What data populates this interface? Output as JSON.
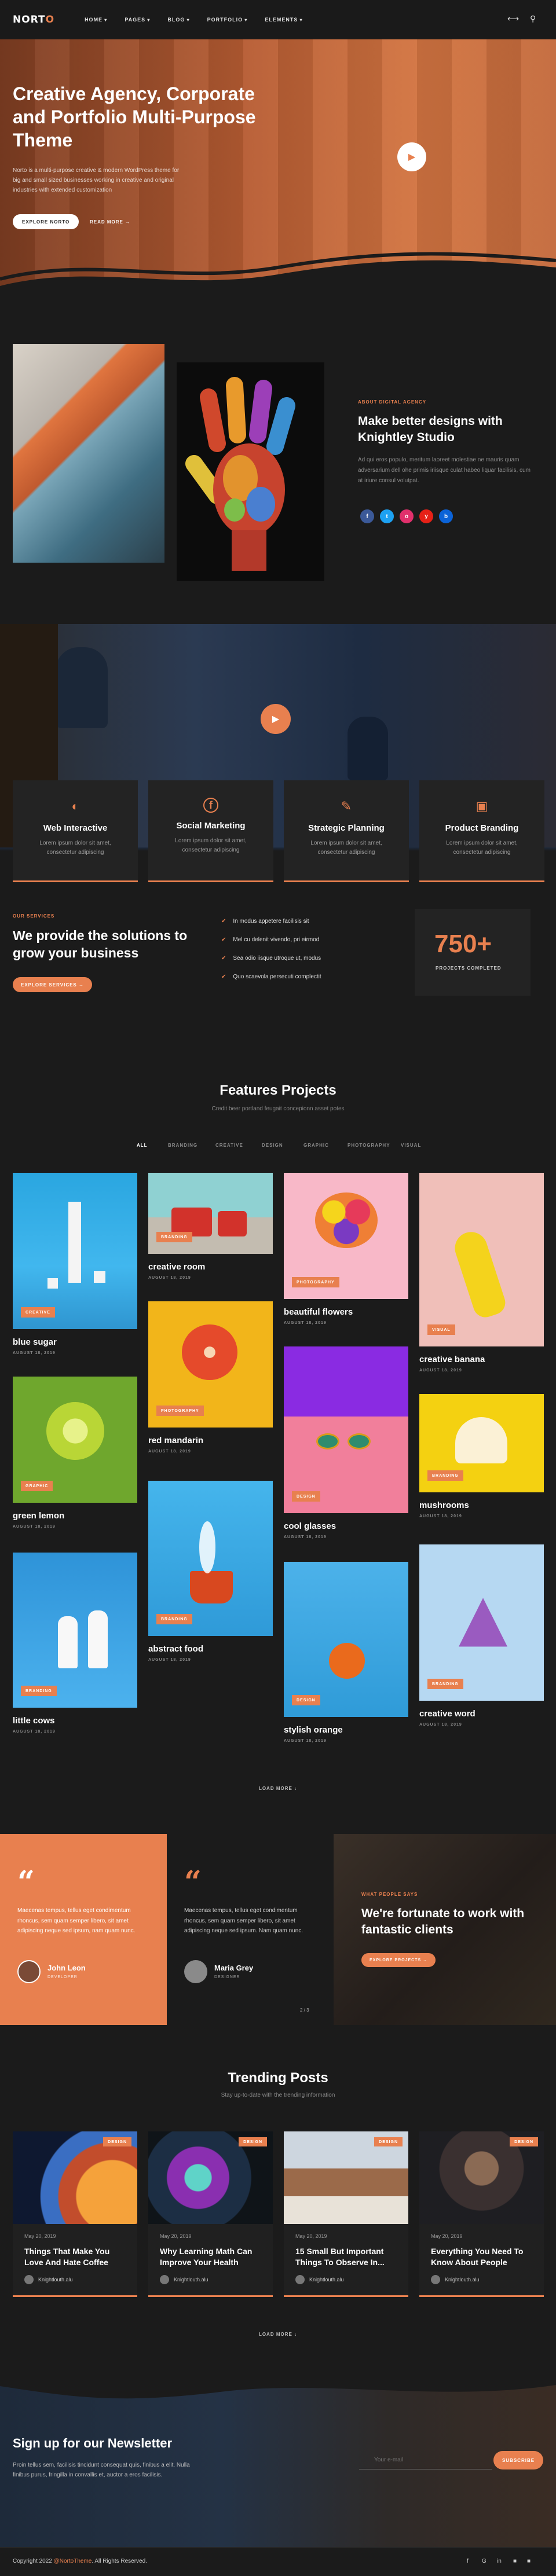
{
  "nav": {
    "logo_main": "NORT",
    "logo_accent": "O",
    "items": [
      "HOME",
      "PAGES",
      "BLOG",
      "PORTFOLIO",
      "ELEMENTS"
    ]
  },
  "hero": {
    "title": "Creative Agency, Corporate and Portfolio Multi-Purpose Theme",
    "text": "Norto is a multi-purpose creative & modern WordPress theme for big and small sized businesses working in creative and original industries with extended customization",
    "primary_button": "EXPLORE NORTO",
    "secondary_button": "READ MORE →"
  },
  "about": {
    "kicker": "ABOUT DIGITAL AGENCY",
    "title": "Make better designs with Knightley Studio",
    "text": "Ad qui eros populo, meritum laoreet molestiae ne mauris quam adversarium dell ohe primis iriisque culat habeo liquar facilisis, cum at iriure consul volutpat.",
    "socials": [
      "f",
      "t",
      "o",
      "y",
      "b"
    ]
  },
  "services": [
    {
      "icon": "palette-icon",
      "glyph": "◐",
      "title": "Web Interactive",
      "text": "Lorem ipsum dolor sit amet, consectetur adipiscing"
    },
    {
      "icon": "facebook-icon",
      "glyph": "f",
      "title": "Social Marketing",
      "text": "Lorem ipsum dolor sit amet, consectetur adipiscing"
    },
    {
      "icon": "pencil-icon",
      "glyph": "✎",
      "title": "Strategic Planning",
      "text": "Lorem ipsum dolor sit amet, consectetur adipiscing"
    },
    {
      "icon": "basket-icon",
      "glyph": "▣",
      "title": "Product Branding",
      "text": "Lorem ipsum dolor sit amet, consectetur adipiscing"
    }
  ],
  "solutions": {
    "kicker": "OUR SERVICES",
    "title": "We provide the solutions to grow your business",
    "button": "EXPLORE SERVICES →",
    "checks": [
      "In modus appetere facilisis sit",
      "Mel cu delenit vivendo, pri eirmod",
      "Sea odio iisque utroque ut, modus",
      "Quo scaevola persecuti complectit"
    ],
    "counter": "750+",
    "counter_label": "PROJECTS COMPLETED"
  },
  "projects": {
    "title": "Features Projects",
    "subtitle": "Credit beer portland feugait concepionn asset potes",
    "filters": [
      "ALL",
      "BRANDING",
      "CREATIVE",
      "DESIGN",
      "GRAPHIC",
      "PHOTOGRAPHY",
      "VISUAL"
    ],
    "items": [
      {
        "title": "blue sugar",
        "date": "AUGUST 18, 2019",
        "tag": "CREATIVE"
      },
      {
        "title": "green lemon",
        "date": "AUGUST 18, 2019",
        "tag": "GRAPHIC"
      },
      {
        "title": "little cows",
        "date": "AUGUST 18, 2019",
        "tag": "BRANDING"
      },
      {
        "title": "creative room",
        "date": "AUGUST 18, 2019",
        "tag": "BRANDING"
      },
      {
        "title": "red mandarin",
        "date": "AUGUST 18, 2019",
        "tag": "PHOTOGRAPHY"
      },
      {
        "title": "abstract food",
        "date": "AUGUST 18, 2019",
        "tag": "BRANDING"
      },
      {
        "title": "beautiful flowers",
        "date": "AUGUST 18, 2019",
        "tag": "PHOTOGRAPHY"
      },
      {
        "title": "cool glasses",
        "date": "AUGUST 18, 2019",
        "tag": "DESIGN"
      },
      {
        "title": "stylish orange",
        "date": "AUGUST 18, 2019",
        "tag": "DESIGN"
      },
      {
        "title": "creative banana",
        "date": "AUGUST 18, 2019",
        "tag": "VISUAL"
      },
      {
        "title": "mushrooms",
        "date": "AUGUST 18, 2019",
        "tag": "BRANDING"
      },
      {
        "title": "creative word",
        "date": "AUGUST 18, 2019",
        "tag": "BRANDING"
      }
    ],
    "load_more": "LOAD MORE ↓"
  },
  "testimonials": {
    "items": [
      {
        "quote": "Maecenas tempus, tellus eget condimentum rhoncus, sem quam semper libero, sit amet adipiscing neque sed ipsum, nam quam nunc.",
        "name": "John Leon",
        "role": "DEVELOPER"
      },
      {
        "quote": "Maecenas tempus, tellus eget condimentum rhoncus, sem quam semper libero, sit amet adipiscing neque sed ipsum. Nam quam nunc.",
        "name": "Maria Grey",
        "role": "DESIGNER"
      }
    ],
    "pager": "2 / 3",
    "kicker": "WHAT PEOPLE SAYS",
    "title": "We're fortunate to work with fantastic clients",
    "button": "EXPLORE PROJECTS →"
  },
  "posts": {
    "title": "Trending Posts",
    "subtitle": "Stay up-to-date with the trending information",
    "items": [
      {
        "category": "DESIGN",
        "date": "May 20, 2019",
        "title": "Things That Make You Love And Hate Coffee",
        "author": "Knightlouth.alu"
      },
      {
        "category": "DESIGN",
        "date": "May 20, 2019",
        "title": "Why Learning Math Can Improve Your Health",
        "author": "Knightlouth.alu"
      },
      {
        "category": "DESIGN",
        "date": "May 20, 2019",
        "title": "15 Small But Important Things To Observe In...",
        "author": "Knightlouth.alu"
      },
      {
        "category": "DESIGN",
        "date": "May 20, 2019",
        "title": "Everything You Need To Know About People",
        "author": "Knightlouth.alu"
      }
    ],
    "load_more": "LOAD MORE ↓"
  },
  "newsletter": {
    "title": "Sign up for our Newsletter",
    "text": "Proin tellus sem, facilisis tincidunt consequat quis, finibus a elit. Nulla finibus purus, fringilla in convallis et, auctor a eros facilisis.",
    "placeholder": "Your e-mail",
    "button": "SUBSCRIBE"
  },
  "footer": {
    "copyright_prefix": "Copyright 2022 ",
    "copyright_brand": "@NortoTheme",
    "copyright_suffix": ". All Rights Reserved.",
    "socials": [
      "f",
      "G",
      "in",
      "■",
      "■"
    ]
  }
}
